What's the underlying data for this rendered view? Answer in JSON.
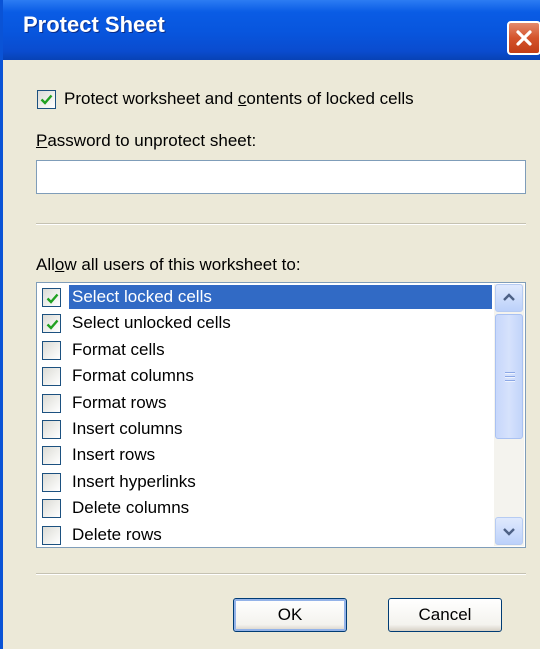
{
  "window": {
    "title": "Protect Sheet",
    "close_icon": "close-icon"
  },
  "protect_checkbox": {
    "checked": true,
    "label_pre": "Protect worksheet and ",
    "label_mnemonic": "c",
    "label_post": "ontents of locked cells"
  },
  "password": {
    "label_mnemonic": "P",
    "label_post": "assword to unprotect sheet:",
    "value": ""
  },
  "allow": {
    "label_pre": "All",
    "label_mnemonic": "o",
    "label_post": "w all users of this worksheet to:",
    "items": [
      {
        "label": "Select locked cells",
        "checked": true,
        "selected": true
      },
      {
        "label": "Select unlocked cells",
        "checked": true,
        "selected": false
      },
      {
        "label": "Format cells",
        "checked": false,
        "selected": false
      },
      {
        "label": "Format columns",
        "checked": false,
        "selected": false
      },
      {
        "label": "Format rows",
        "checked": false,
        "selected": false
      },
      {
        "label": "Insert columns",
        "checked": false,
        "selected": false
      },
      {
        "label": "Insert rows",
        "checked": false,
        "selected": false
      },
      {
        "label": "Insert hyperlinks",
        "checked": false,
        "selected": false
      },
      {
        "label": "Delete columns",
        "checked": false,
        "selected": false
      },
      {
        "label": "Delete rows",
        "checked": false,
        "selected": false
      }
    ]
  },
  "buttons": {
    "ok": "OK",
    "cancel": "Cancel"
  },
  "colors": {
    "titlebar": "#0855dd",
    "selection": "#316ac5",
    "check": "#21a121",
    "dialog_bg": "#ece9d8"
  }
}
